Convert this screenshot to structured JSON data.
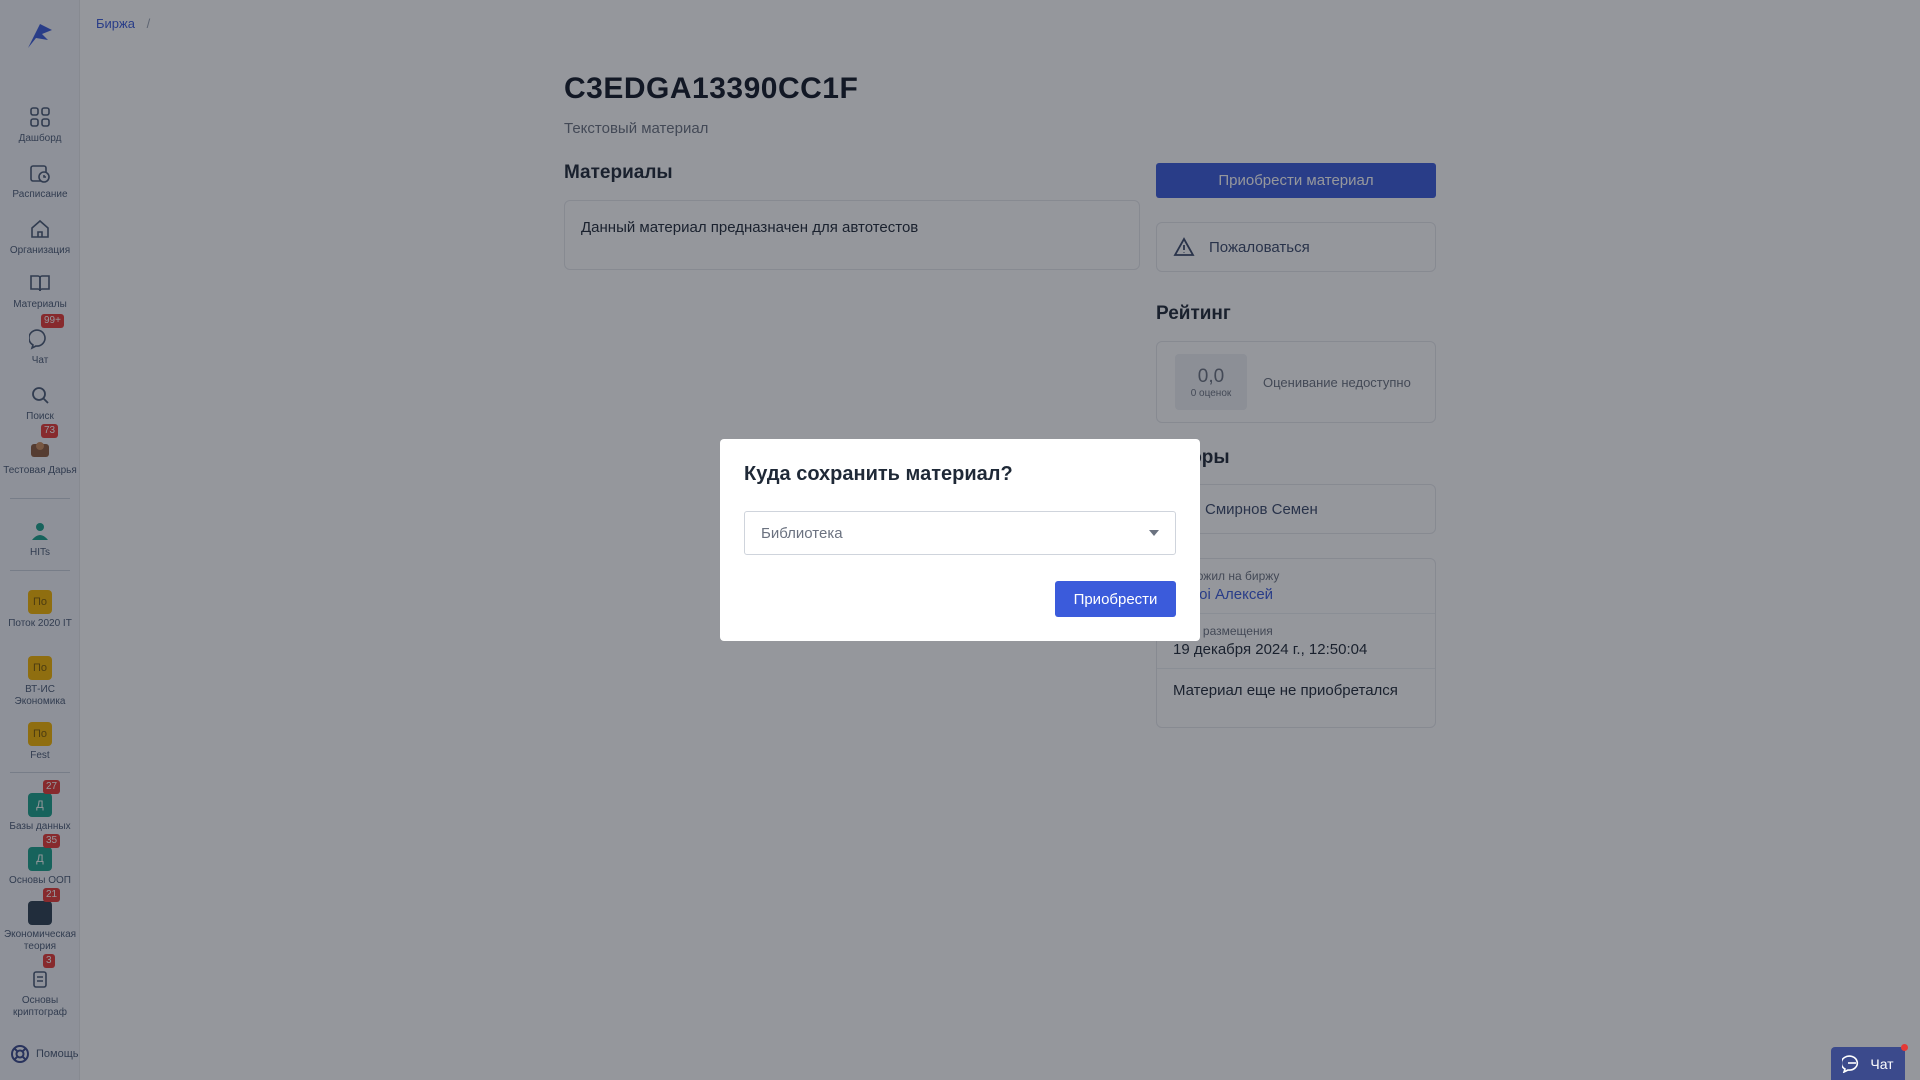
{
  "sidebar": {
    "items": [
      {
        "label": "Дашборд",
        "icon": "grid-icon"
      },
      {
        "label": "Расписание",
        "icon": "calendar-clock-icon"
      },
      {
        "label": "Организация",
        "icon": "home-icon"
      },
      {
        "label": "Материалы",
        "icon": "book-icon"
      },
      {
        "label": "Чат",
        "icon": "chat-icon",
        "badge": "99+"
      },
      {
        "label": "Поиск",
        "icon": "search-icon"
      },
      {
        "label": "Тестовая Дарья",
        "icon": "avatar-icon",
        "badge": "73"
      },
      {
        "label": "HITs",
        "icon": "person-icon"
      },
      {
        "label": "Поток 2020 IT",
        "icon": "group-icon",
        "abbr": "По"
      },
      {
        "label": "ВТ-ИС Экономика",
        "icon": "group-icon",
        "abbr": "По"
      },
      {
        "label": "Fest",
        "icon": "group-icon",
        "abbr": "По"
      },
      {
        "label": "Базы данных",
        "icon": "course-icon",
        "abbr": "Д",
        "badge": "27"
      },
      {
        "label": "Основы ООП",
        "icon": "course-icon",
        "abbr": "Д",
        "badge": "35"
      },
      {
        "label": "Экономическая теория",
        "icon": "course-icon",
        "badge": "21"
      },
      {
        "label": "Основы криптограф",
        "icon": "course-icon",
        "badge": "3"
      }
    ],
    "help_label": "Помощь"
  },
  "breadcrumb": {
    "root": "Биржа",
    "separator": "/"
  },
  "material": {
    "code": "C3EDGA13390CC1F",
    "type": "Текстовый материал",
    "section_title": "Материалы",
    "description": "Данный материал предназначен для автотестов"
  },
  "actions": {
    "buy_label": "Приобрести материал",
    "complain_label": "Пожаловаться"
  },
  "rating": {
    "title": "Рейтинг",
    "score": "0,0",
    "count": "0 оценок",
    "note": "Оценивание недоступно"
  },
  "authors": {
    "title": "Авторы",
    "items": [
      "Смирнов Семен"
    ]
  },
  "info": {
    "posted_by_label": "Выложил на биржу",
    "posted_by": "Бoвoi Алексей",
    "date_label": "Дата размещения",
    "date": "19 декабря 2024 г., 12:50:04",
    "status": "Материал еще не приобретался"
  },
  "modal": {
    "title": "Куда сохранить материал?",
    "select_placeholder": "Библиотека",
    "confirm_label": "Приобрести"
  },
  "chat_button": {
    "label": "Чат"
  },
  "colors": {
    "primary": "#3b5bdb",
    "badge": "#e53935",
    "sidebar_bg": "#f3f5f9"
  }
}
